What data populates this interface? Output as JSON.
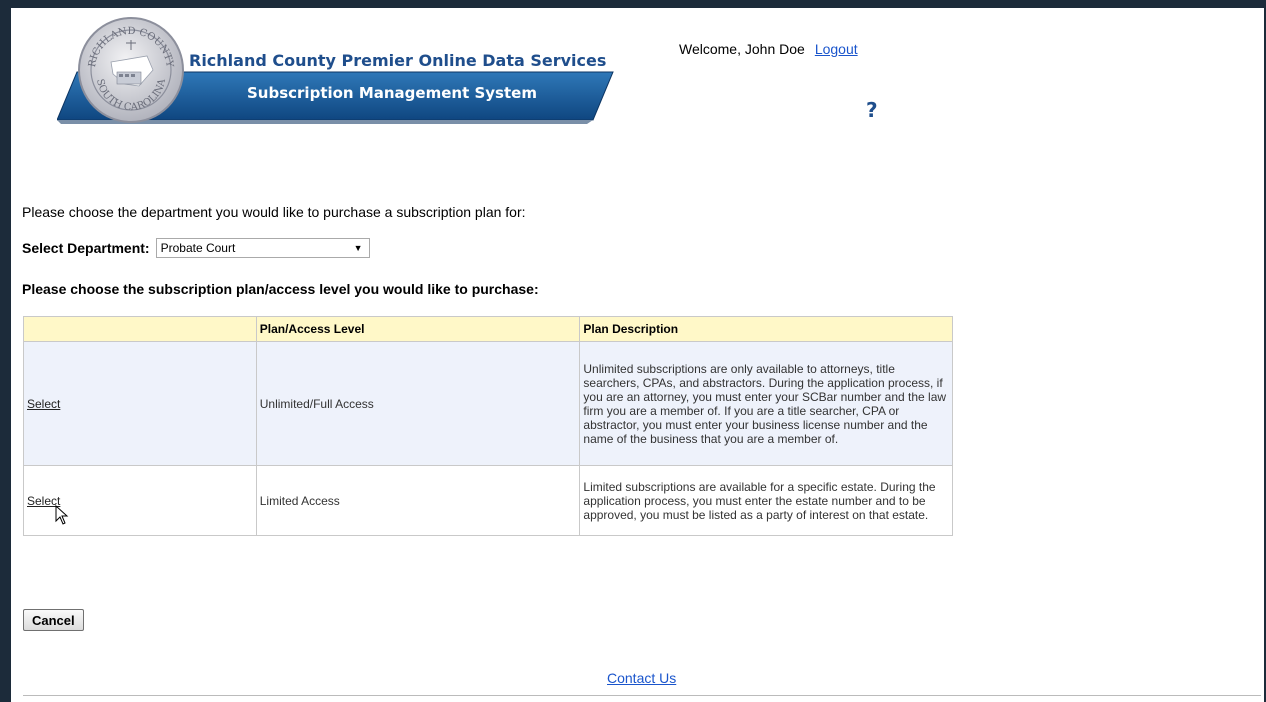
{
  "header": {
    "seal_text_top": "RICHLAND COUNTY",
    "seal_text_bottom": "SOUTH CAROLINA",
    "title": "Richland County Premier Online Data Services",
    "subtitle": "Subscription Management System",
    "welcome": "Welcome, John Doe",
    "logout": "Logout",
    "help": "?"
  },
  "form": {
    "intro": "Please choose the department you would like to purchase a subscription plan for:",
    "dept_label": "Select Department:",
    "dept_value": "Probate Court",
    "plan_heading": "Please choose the subscription plan/access level you would like to purchase:"
  },
  "table": {
    "headers": [
      "",
      "Plan/Access Level",
      "Plan Description"
    ],
    "rows": [
      {
        "action": "Select",
        "level": "Unlimited/Full Access",
        "description": "Unlimited subscriptions are only available to attorneys, title searchers, CPAs, and abstractors. During the application process, if you are an attorney, you must enter your SCBar number and the law firm you are a member of. If you are a title searcher, CPA or abstractor, you must enter your business license number and the name of the business that you are a member of."
      },
      {
        "action": "Select",
        "level": "Limited Access",
        "description": "Limited subscriptions are available for a specific estate. During the application process, you must enter the estate number and to be approved, you must be listed as a party of interest on that estate."
      }
    ]
  },
  "footer": {
    "cancel": "Cancel",
    "contact": "Contact Us"
  },
  "colors": {
    "brand_blue": "#1f4e8c",
    "header_row": "#fff8c8",
    "link": "#1a55cc"
  }
}
